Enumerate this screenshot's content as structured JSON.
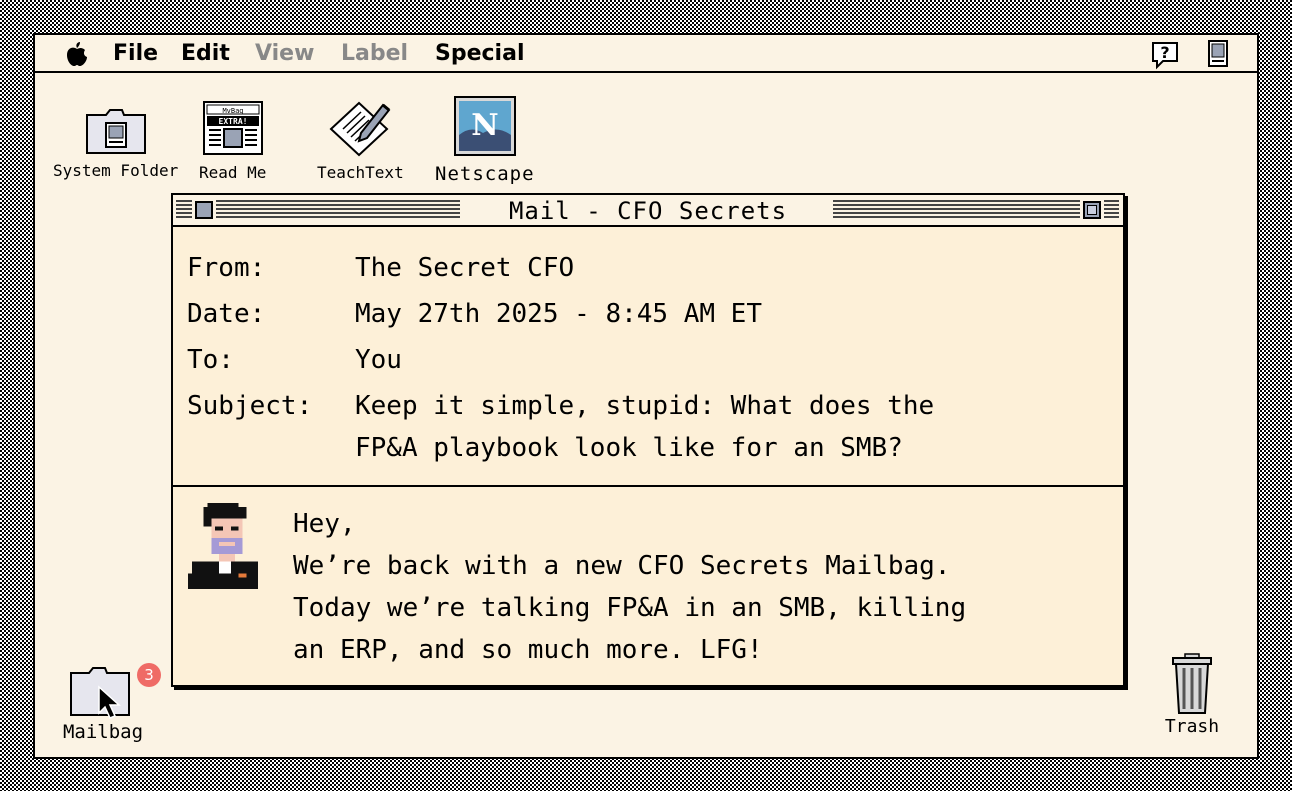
{
  "menubar": {
    "items": [
      {
        "label": "File",
        "enabled": true
      },
      {
        "label": "Edit",
        "enabled": true
      },
      {
        "label": "View",
        "enabled": false
      },
      {
        "label": "Label",
        "enabled": false
      },
      {
        "label": "Special",
        "enabled": true
      }
    ],
    "icons": [
      "apple-icon",
      "help-icon",
      "finder-icon"
    ]
  },
  "desktop": {
    "icons": [
      {
        "label": "System Folder",
        "icon": "system-folder-icon"
      },
      {
        "label": "Read Me",
        "icon": "newspaper-icon",
        "artwork_text": [
          "MvBag",
          "EXTRA!"
        ]
      },
      {
        "label": "TeachText",
        "icon": "teachtext-icon"
      },
      {
        "label": "Netscape",
        "icon": "netscape-icon",
        "artwork_text": "N"
      }
    ],
    "mailbag": {
      "label": "Mailbag",
      "badge": "3",
      "icon": "folder-icon"
    },
    "trash": {
      "label": "Trash",
      "icon": "trash-can-icon"
    }
  },
  "window": {
    "title": "Mail - CFO Secrets",
    "headers": [
      {
        "label": "From:",
        "value": "The Secret CFO"
      },
      {
        "label": "Date:",
        "value": "May 27th 2025 - 8:45 AM ET"
      },
      {
        "label": "To:",
        "value": "You"
      },
      {
        "label": "Subject:",
        "value": "Keep it simple, stupid: What does the"
      }
    ],
    "subject_line2": "FP&A playbook look like for an SMB?",
    "body": [
      "Hey,",
      "We’re back with a new CFO Secrets Mailbag.",
      "Today we’re talking FP&A in an SMB, killing",
      "an ERP, and so much more. LFG!"
    ],
    "avatar_icon": "pixel-avatar-icon"
  },
  "colors": {
    "desktop": "#fbf3e4",
    "window_bg": "#fdf0d8",
    "badge": "#ef6b66",
    "icon_blue": "#9aa3b5"
  }
}
